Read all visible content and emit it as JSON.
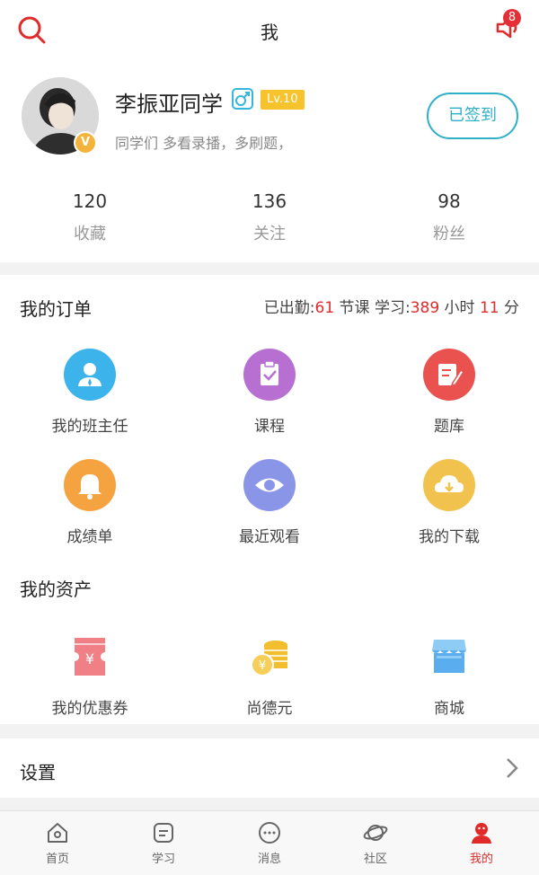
{
  "header": {
    "title": "我",
    "notice_count": "8"
  },
  "profile": {
    "name": "李振亚同学",
    "level": "Lv.10",
    "motto": "同学们 多看录播，多刷题，",
    "vip_mark": "V",
    "checkin_label": "已签到",
    "stats": [
      {
        "value": "120",
        "label": "收藏"
      },
      {
        "value": "136",
        "label": "关注"
      },
      {
        "value": "98",
        "label": "粉丝"
      }
    ]
  },
  "orders": {
    "title": "我的订单",
    "attendance": {
      "prefix1": "已出勤:",
      "sessions": "61",
      "unit1": " 节课 学习:",
      "hours": "389",
      "unit2": " 小时 ",
      "minutes": "11",
      "unit3": " 分"
    },
    "items": [
      {
        "label": "我的班主任",
        "icon": "teacher-icon",
        "color": "#3db3ec"
      },
      {
        "label": "课程",
        "icon": "clipboard-check-icon",
        "color": "#b770d2"
      },
      {
        "label": "题库",
        "icon": "edit-icon",
        "color": "#e9524f"
      },
      {
        "label": "成绩单",
        "icon": "bell-icon",
        "color": "#f5a341"
      },
      {
        "label": "最近观看",
        "icon": "eye-icon",
        "color": "#8b95e8"
      },
      {
        "label": "我的下载",
        "icon": "cloud-download-icon",
        "color": "#f1c24e"
      }
    ]
  },
  "assets": {
    "title": "我的资产",
    "items": [
      {
        "label": "我的优惠券",
        "icon": "coupon-icon",
        "color": "#f07f86"
      },
      {
        "label": "尚德元",
        "icon": "coins-icon",
        "color": "#f2be2e"
      },
      {
        "label": "商城",
        "icon": "store-icon",
        "color": "#5aaef0"
      }
    ]
  },
  "settings": {
    "label": "设置"
  },
  "tabbar": [
    {
      "label": "首页",
      "icon": "home-icon"
    },
    {
      "label": "学习",
      "icon": "study-icon"
    },
    {
      "label": "消息",
      "icon": "message-icon"
    },
    {
      "label": "社区",
      "icon": "planet-icon"
    },
    {
      "label": "我的",
      "icon": "profile-icon",
      "active": true
    }
  ],
  "colors": {
    "accent": "#e02b2b",
    "checkin": "#2db0c8",
    "level": "#f6c32c"
  }
}
